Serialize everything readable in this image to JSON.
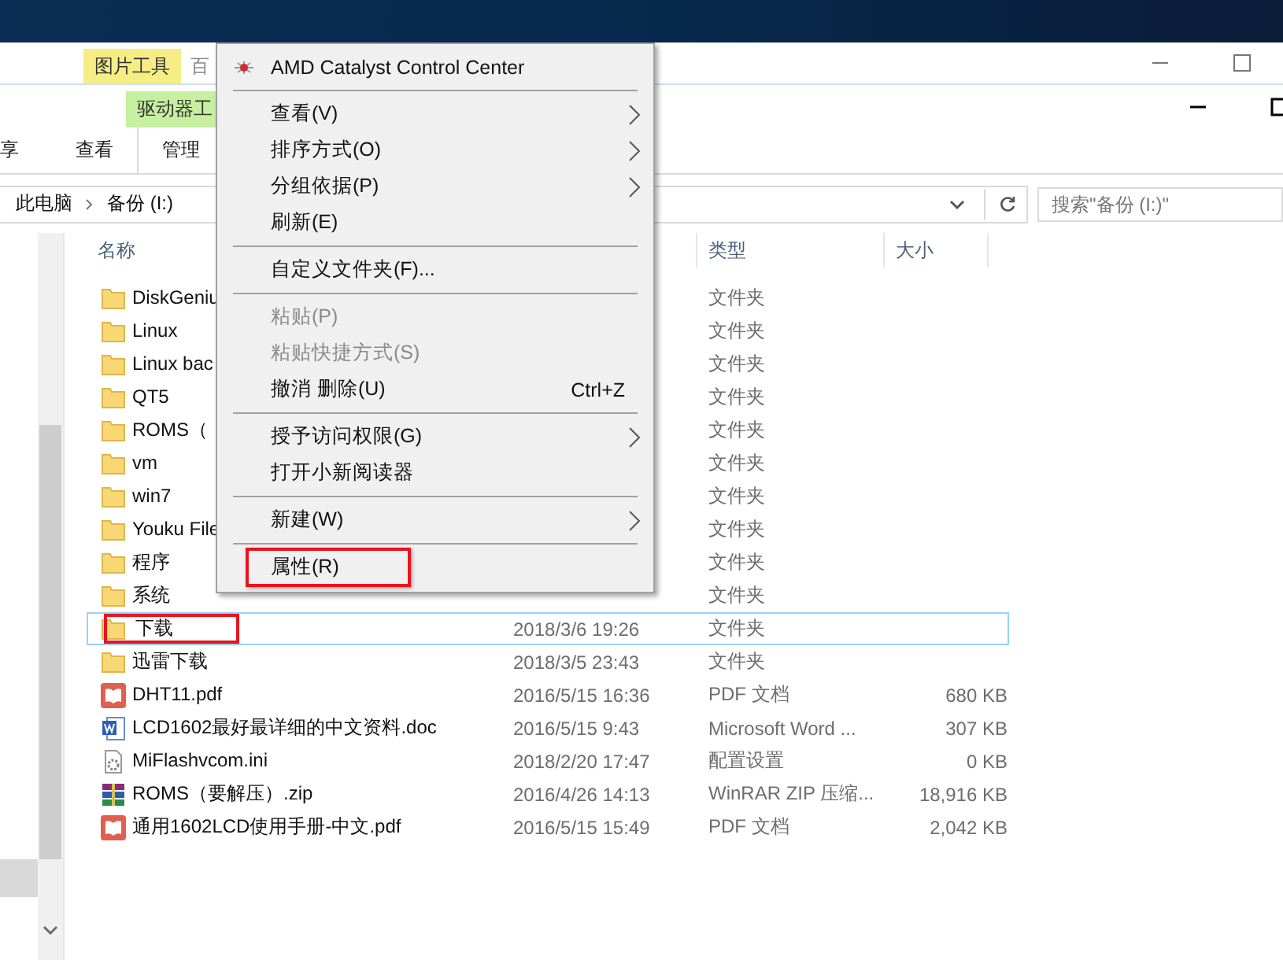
{
  "title_bar": {
    "context_tab": "图片工具",
    "cut_tab": "百"
  },
  "context_row": {
    "tab": "驱动器工"
  },
  "ribbon_tabs": [
    {
      "label": "享",
      "selected": false
    },
    {
      "label": "查看",
      "selected": false
    },
    {
      "label": "管理",
      "selected": true
    }
  ],
  "address_bar": {
    "crumbs": [
      "此电脑",
      "备份 (I:)"
    ]
  },
  "search": {
    "placeholder": "搜索\"备份 (I:)\""
  },
  "columns": [
    "名称",
    "类型",
    "大小"
  ],
  "rows": [
    {
      "kind": "folder",
      "name": "DiskGeniu",
      "type": "文件夹",
      "selected": false,
      "annotated": false
    },
    {
      "kind": "folder",
      "name": "Linux",
      "type": "文件夹",
      "selected": false,
      "annotated": false
    },
    {
      "kind": "folder",
      "name": "Linux bac",
      "type": "文件夹",
      "selected": false,
      "annotated": false
    },
    {
      "kind": "folder",
      "name": "QT5",
      "type": "文件夹",
      "selected": false,
      "annotated": false
    },
    {
      "kind": "folder",
      "name": "ROMS（",
      "type": "文件夹",
      "selected": false,
      "annotated": false
    },
    {
      "kind": "folder",
      "name": "vm",
      "type": "文件夹",
      "selected": false,
      "annotated": false
    },
    {
      "kind": "folder",
      "name": "win7",
      "type": "文件夹",
      "selected": false,
      "annotated": false
    },
    {
      "kind": "folder",
      "name": "Youku File",
      "type": "文件夹",
      "selected": false,
      "annotated": false
    },
    {
      "kind": "folder",
      "name": "程序",
      "type": "文件夹",
      "selected": false,
      "annotated": false
    },
    {
      "kind": "folder",
      "name": "系统",
      "type": "文件夹",
      "selected": false,
      "annotated": false
    },
    {
      "kind": "folder",
      "name": "下载",
      "date": "2018/3/6 19:26",
      "type": "文件夹",
      "selected": true,
      "annotated": true
    },
    {
      "kind": "folder",
      "name": "迅雷下载",
      "date": "2018/3/5 23:43",
      "type": "文件夹",
      "selected": false,
      "annotated": false
    },
    {
      "kind": "pdf",
      "name": "DHT11.pdf",
      "date": "2016/5/15 16:36",
      "type": "PDF 文档",
      "size": "680 KB",
      "selected": false,
      "annotated": false
    },
    {
      "kind": "doc",
      "name": "LCD1602最好最详细的中文资料.doc",
      "date": "2016/5/15 9:43",
      "type": "Microsoft Word ...",
      "size": "307 KB",
      "selected": false,
      "annotated": false
    },
    {
      "kind": "ini",
      "name": "MiFlashvcom.ini",
      "date": "2018/2/20 17:47",
      "type": "配置设置",
      "size": "0 KB",
      "selected": false,
      "annotated": false
    },
    {
      "kind": "zip",
      "name": "ROMS（要解压）.zip",
      "date": "2016/4/26 14:13",
      "type": "WinRAR ZIP 压缩...",
      "size": "18,916 KB",
      "selected": false,
      "annotated": false
    },
    {
      "kind": "pdf",
      "name": "通用1602LCD使用手册-中文.pdf",
      "date": "2016/5/15 15:49",
      "type": "PDF 文档",
      "size": "2,042 KB",
      "selected": false,
      "annotated": false
    }
  ],
  "context_menu": {
    "groups": [
      [
        {
          "kind": "app",
          "label": "AMD Catalyst Control Center",
          "submenu": false,
          "disabled": false,
          "annotated": false
        }
      ],
      [
        {
          "kind": "plain",
          "label": "查看(V)",
          "submenu": true,
          "disabled": false,
          "annotated": false
        },
        {
          "kind": "plain",
          "label": "排序方式(O)",
          "submenu": true,
          "disabled": false,
          "annotated": false
        },
        {
          "kind": "plain",
          "label": "分组依据(P)",
          "submenu": true,
          "disabled": false,
          "annotated": false
        },
        {
          "kind": "plain",
          "label": "刷新(E)",
          "submenu": false,
          "disabled": false,
          "annotated": false
        }
      ],
      [
        {
          "kind": "plain",
          "label": "自定义文件夹(F)...",
          "submenu": false,
          "disabled": false,
          "annotated": false
        }
      ],
      [
        {
          "kind": "plain",
          "label": "粘贴(P)",
          "submenu": false,
          "disabled": true,
          "annotated": false
        },
        {
          "kind": "plain",
          "label": "粘贴快捷方式(S)",
          "submenu": false,
          "disabled": true,
          "annotated": false
        },
        {
          "kind": "plain",
          "label": "撤消 删除(U)",
          "shortcut": "Ctrl+Z",
          "submenu": false,
          "disabled": false,
          "annotated": false
        }
      ],
      [
        {
          "kind": "plain",
          "label": "授予访问权限(G)",
          "submenu": true,
          "disabled": false,
          "annotated": false
        },
        {
          "kind": "plain",
          "label": "打开小新阅读器",
          "submenu": false,
          "disabled": false,
          "annotated": false
        }
      ],
      [
        {
          "kind": "plain",
          "label": "新建(W)",
          "submenu": true,
          "disabled": false,
          "annotated": false
        }
      ],
      [
        {
          "kind": "plain",
          "label": "属性(R)",
          "submenu": false,
          "disabled": false,
          "annotated": true
        }
      ]
    ]
  }
}
